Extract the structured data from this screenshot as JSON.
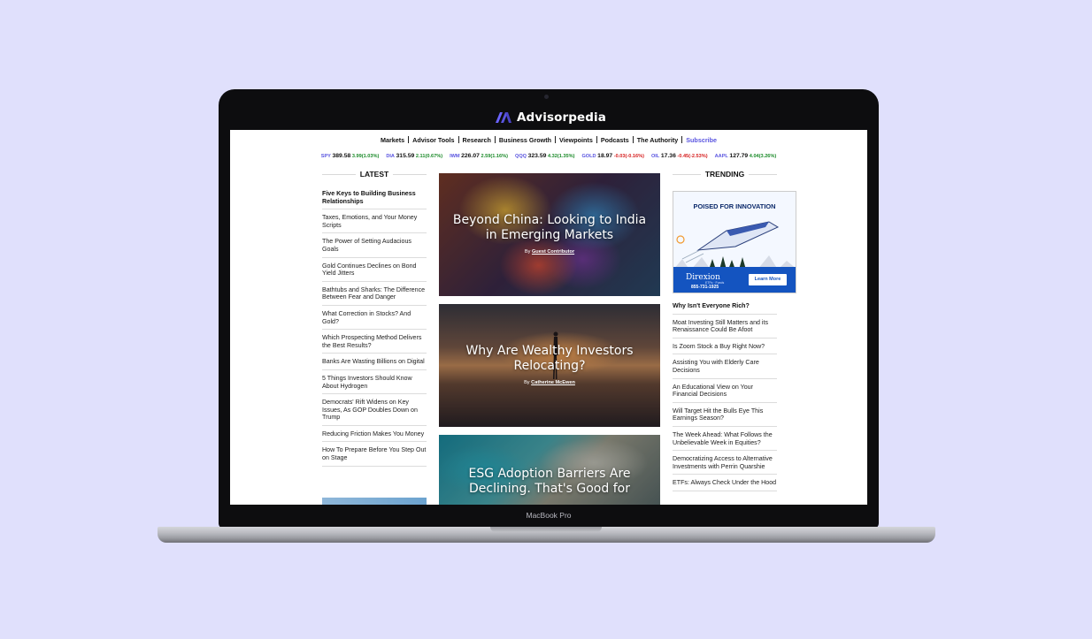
{
  "brand": {
    "name": "Advisorpedia",
    "device_label": "MacBook Pro"
  },
  "colors": {
    "accent": "#5a55e0",
    "page_bg": "#e0e0fc",
    "up": "#1c8b2a",
    "down": "#d62020"
  },
  "nav": {
    "items": [
      "Markets",
      "Advisor Tools",
      "Research",
      "Business Growth",
      "Viewpoints",
      "Podcasts",
      "The Authority"
    ],
    "subscribe": "Subscribe"
  },
  "ticker": [
    {
      "symbol": "SPY",
      "price": "389.58",
      "change": "3.99(1.03%)",
      "direction": "up"
    },
    {
      "symbol": "DIA",
      "price": "315.59",
      "change": "2.11(0.67%)",
      "direction": "up"
    },
    {
      "symbol": "IWM",
      "price": "226.07",
      "change": "2.59(1.16%)",
      "direction": "up"
    },
    {
      "symbol": "QQQ",
      "price": "323.59",
      "change": "4.32(1.35%)",
      "direction": "up"
    },
    {
      "symbol": "GOLD",
      "price": "18.97",
      "change": "-0.03(-0.16%)",
      "direction": "down"
    },
    {
      "symbol": "OIL",
      "price": "17.36",
      "change": "-0.45(-2.53%)",
      "direction": "down"
    },
    {
      "symbol": "AAPL",
      "price": "127.79",
      "change": "4.04(3.26%)",
      "direction": "up"
    }
  ],
  "latest": {
    "heading": "LATEST",
    "items": [
      "Five Keys to Building Business Relationships",
      "Taxes, Emotions, and Your Money Scripts",
      "The Power of Setting Audacious Goals",
      "Gold Continues Declines on Bond Yield Jitters",
      "Bathtubs and Sharks: The Difference Between Fear and Danger",
      "What Correction in Stocks? And Gold?",
      "Which Prospecting Method Delivers the Best Results?",
      "Banks Are Wasting Billions on Digital",
      "5 Things Investors Should Know About Hydrogen",
      "Democrats' Rift Widens on Key Issues, As GOP Doubles Down on Trump",
      "Reducing Friction Makes You Money",
      "How To Prepare Before You Step Out on Stage"
    ]
  },
  "features": [
    {
      "title": "Beyond China: Looking to India in Emerging Markets",
      "by": "By",
      "author": "Guest Contributor"
    },
    {
      "title": "Why Are Wealthy Investors Relocating?",
      "by": "By",
      "author": "Catherine McEwen"
    },
    {
      "title": "ESG Adoption Barriers Are Declining. That's Good for",
      "by": "",
      "author": ""
    }
  ],
  "trending": {
    "heading": "TRENDING",
    "ad": {
      "headline": "POISED FOR INNOVATION",
      "brand": "Direxion",
      "tagline": "ETFs · Funds",
      "phone": "855-731-1925",
      "cta": "Learn More"
    },
    "items": [
      "Why Isn't Everyone Rich?",
      "Moat Investing Still Matters and its Renaissance Could Be Afoot",
      "Is Zoom Stock a Buy Right Now?",
      "Assisting You with Elderly Care Decisions",
      "An Educational View on Your Financial Decisions",
      "Will Target Hit the Bulls Eye This Earnings Season?",
      "The Week Ahead: What Follows the Unbelievable Week in Equities?",
      "Democratizing Access to Alternative Investments with Perrin Quarshie",
      "ETFs: Always Check Under the Hood"
    ]
  }
}
